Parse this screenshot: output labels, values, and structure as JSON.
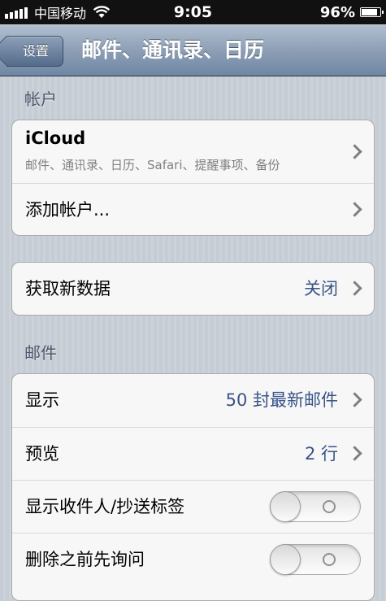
{
  "status_bar": {
    "carrier": "中国移动",
    "time": "9:05",
    "battery_percent_label": "96%",
    "battery_level": 0.96
  },
  "nav": {
    "back_label": "设置",
    "title": "邮件、通讯录、日历"
  },
  "accounts": {
    "header": "帐户",
    "icloud": {
      "title": "iCloud",
      "subtitle": "邮件、通讯录、日历、Safari、提醒事项、备份"
    },
    "add_account": "添加帐户..."
  },
  "fetch": {
    "label": "获取新数据",
    "value": "关闭"
  },
  "mail": {
    "header": "邮件",
    "show": {
      "label": "显示",
      "value": "50 封最新邮件"
    },
    "preview": {
      "label": "预览",
      "value": "2 行"
    },
    "show_to_cc": {
      "label": "显示收件人/抄送标签",
      "on": false
    },
    "ask_before_delete": {
      "label": "删除之前先询问",
      "on": false
    }
  },
  "colors": {
    "value_text": "#385487",
    "background": "#c5ccd4",
    "nav_bar": "#8d9fb6"
  }
}
